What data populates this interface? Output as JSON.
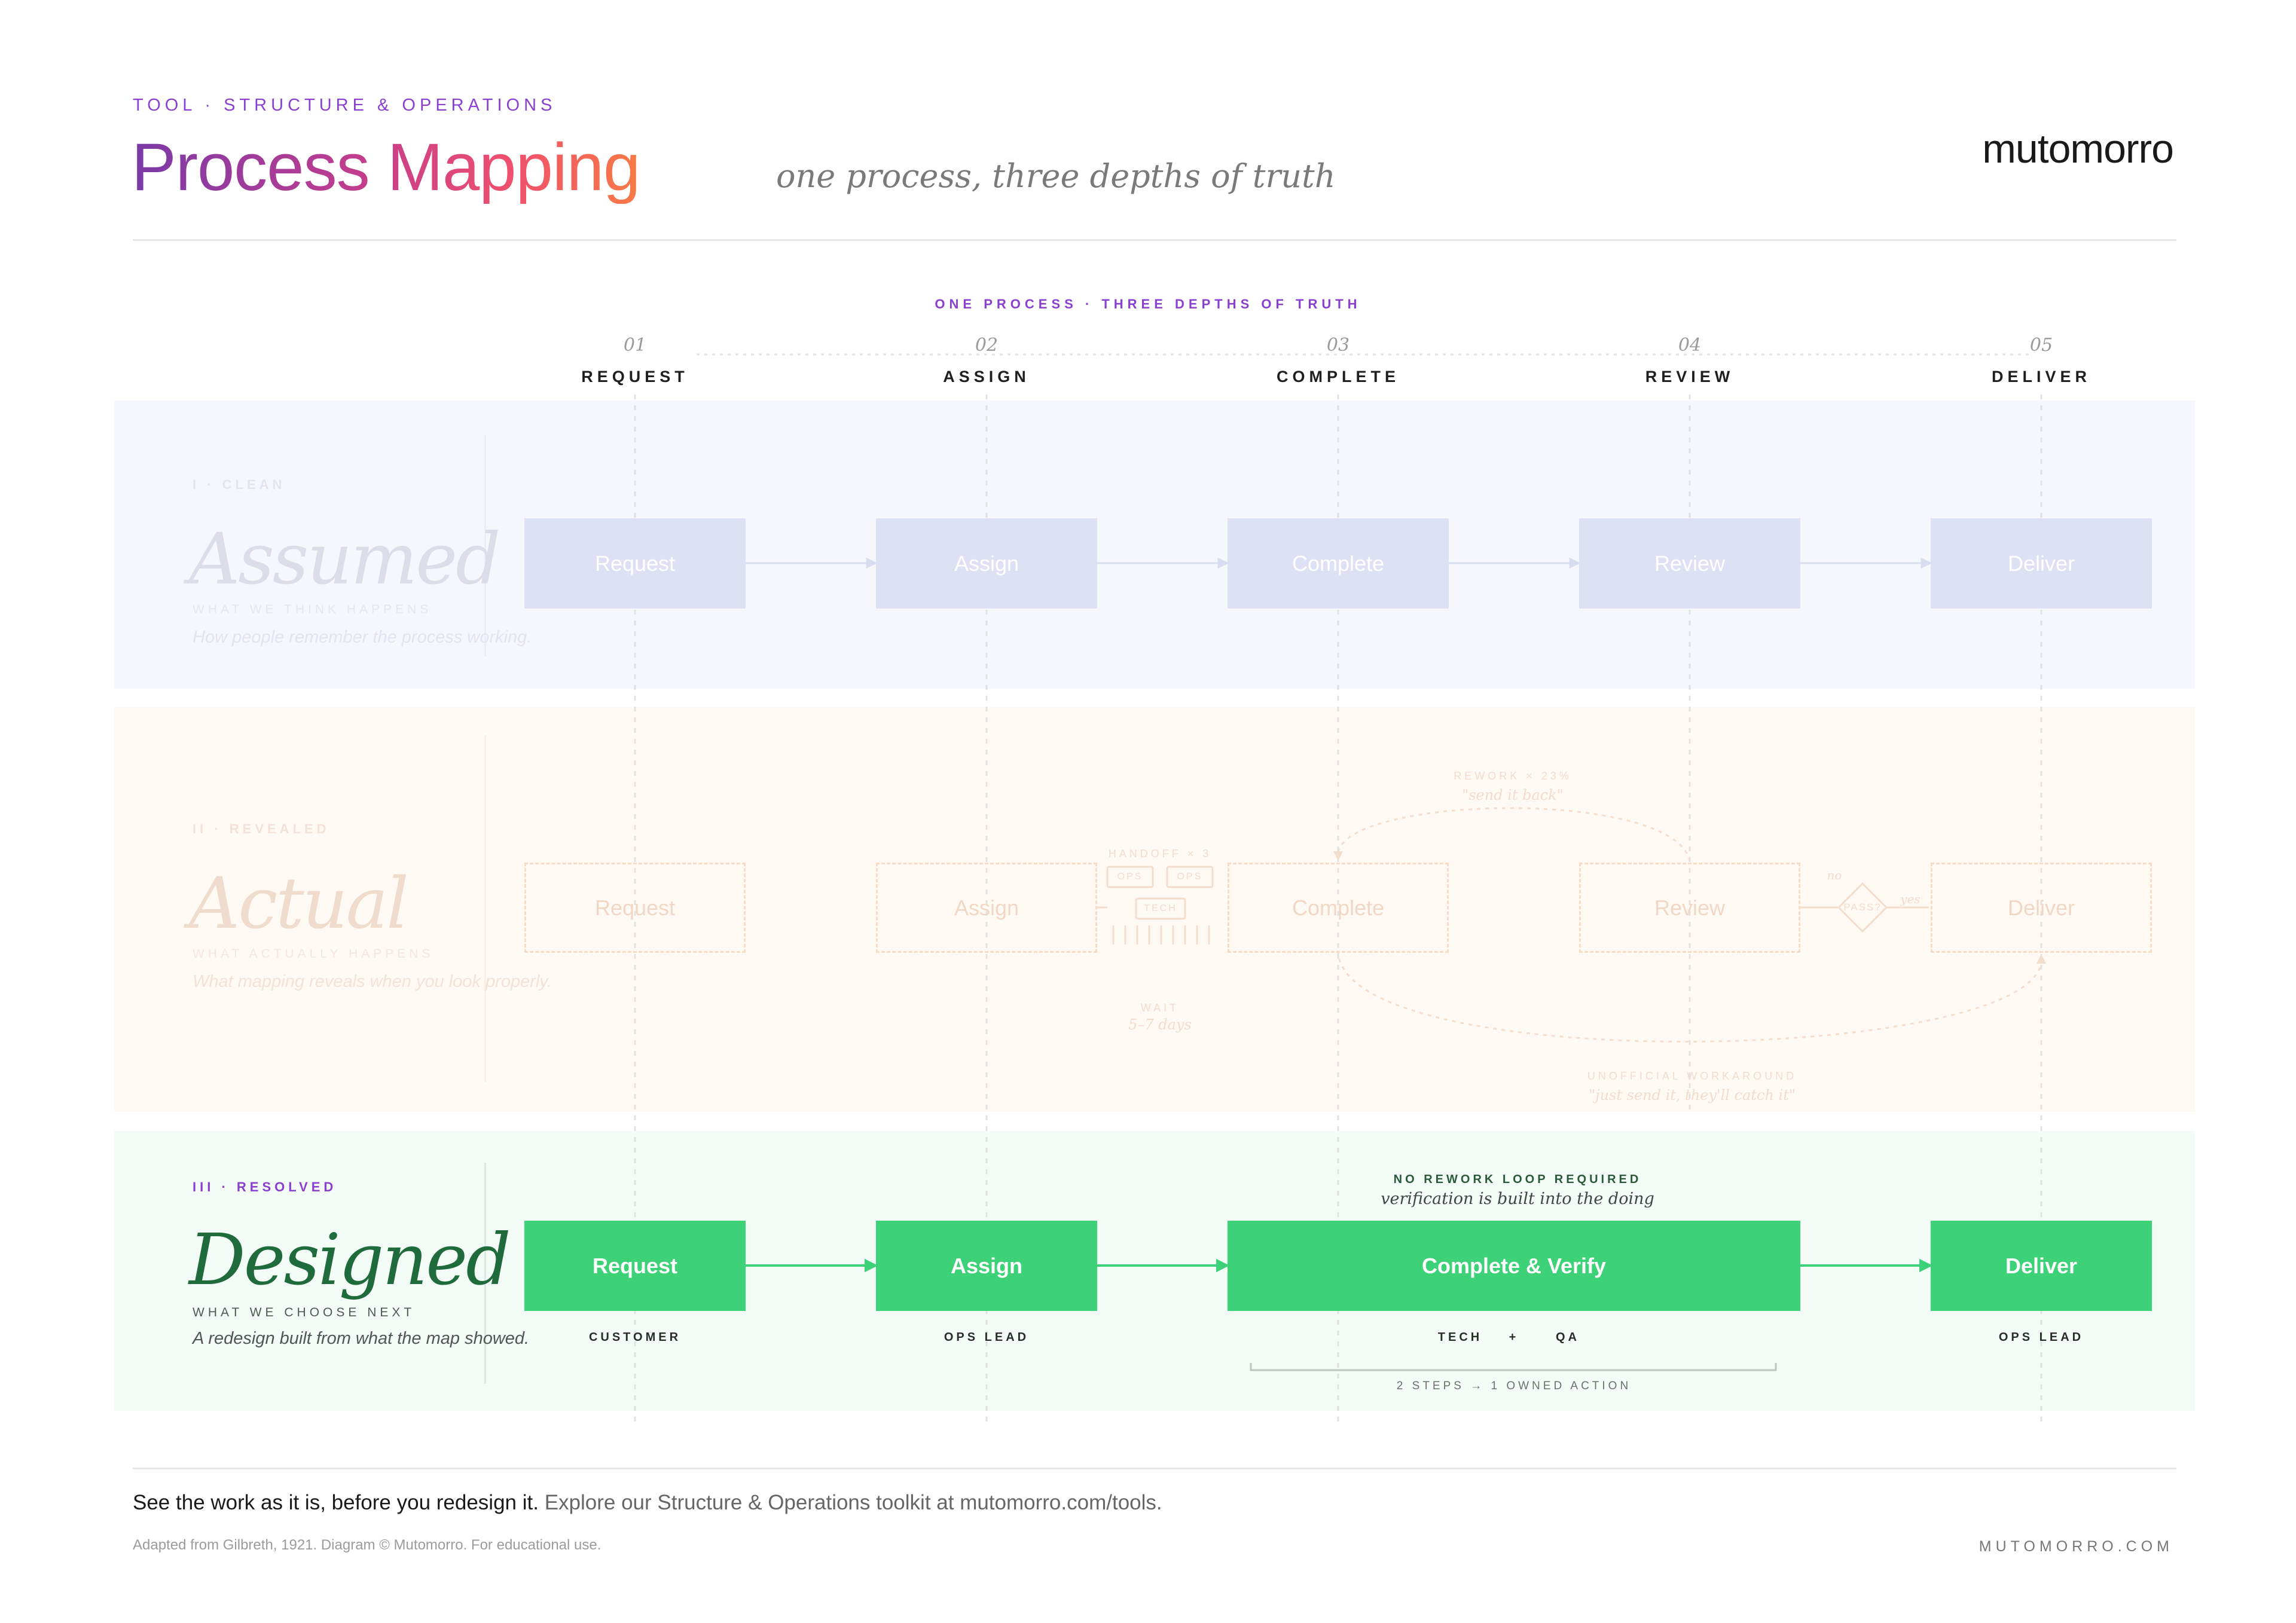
{
  "header": {
    "kicker": "TOOL · STRUCTURE & OPERATIONS",
    "title": "Process Mapping",
    "subtitle": "one process, three depths of truth",
    "brand": "mutomorro"
  },
  "diagram": {
    "section_title": "ONE PROCESS · THREE DEPTHS OF TRUTH",
    "stages": [
      {
        "num": "01",
        "name": "REQUEST"
      },
      {
        "num": "02",
        "name": "ASSIGN"
      },
      {
        "num": "03",
        "name": "COMPLETE"
      },
      {
        "num": "04",
        "name": "REVIEW"
      },
      {
        "num": "05",
        "name": "DELIVER"
      }
    ],
    "assumed": {
      "label": "I · CLEAN",
      "title": "Assumed",
      "sub": "WHAT WE THINK HAPPENS",
      "desc": "How people remember the process working.",
      "boxes": [
        "Request",
        "Assign",
        "Complete",
        "Review",
        "Deliver"
      ]
    },
    "actual": {
      "label": "II · REVEALED",
      "title": "Actual",
      "sub": "WHAT ACTUALLY HAPPENS",
      "desc": "What mapping reveals when you look properly.",
      "boxes": [
        "Request",
        "Assign",
        "Complete",
        "Review",
        "Deliver"
      ],
      "rework_label": "REWORK × 23%",
      "rework_quote": "\"send it back\"",
      "handoff_label": "HANDOFF × 3",
      "handoff_nodes": [
        "OPS",
        "OPS",
        "TECH"
      ],
      "wait_label": "WAIT",
      "wait_value": "5–7 days",
      "decision": "PASS?",
      "decision_no": "no",
      "decision_yes": "yes",
      "workaround_label": "UNOFFICIAL WORKAROUND",
      "workaround_quote": "\"just send it, they'll catch it\""
    },
    "designed": {
      "label": "III · RESOLVED",
      "title": "Designed",
      "sub": "WHAT WE CHOOSE NEXT",
      "desc": "A redesign built from what the map showed.",
      "note_label": "NO REWORK LOOP REQUIRED",
      "note_text": "verification is built into the doing",
      "boxes": [
        "Request",
        "Assign",
        "Complete & Verify",
        "Deliver"
      ],
      "roles": [
        "CUSTOMER",
        "OPS LEAD",
        "TECH",
        "+",
        "QA",
        "OPS LEAD"
      ],
      "bracket_label": "2 STEPS → 1 OWNED ACTION"
    },
    "colors": {
      "accent": "#8b3fd0",
      "designed_green": "#3dd178",
      "designed_title": "#1f6b3c",
      "assumed_box": "#dee1f4",
      "actual_faint": "#f1dccd"
    }
  },
  "footer": {
    "tagline_bold": "See the work as it is, before you redesign it.",
    "tagline_rest": " Explore our Structure & Operations toolkit at mutomorro.com/tools.",
    "credit": "Adapted from Gilbreth, 1921. Diagram © Mutomorro. For educational use.",
    "url": "MUTOMORRO.COM"
  }
}
